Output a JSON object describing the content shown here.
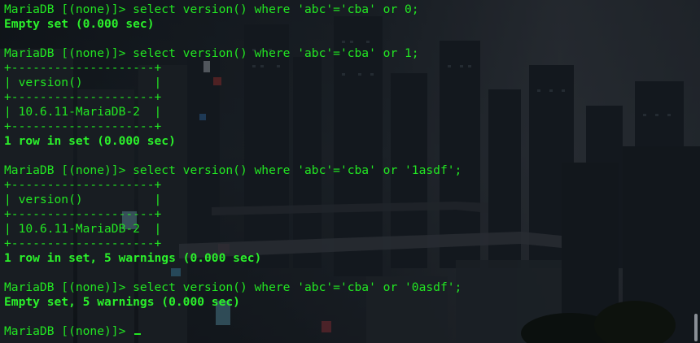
{
  "terminal": {
    "lines": [
      {
        "text": "MariaDB [(none)]> select version() where 'abc'='cba' or 0;",
        "bold": false
      },
      {
        "text": "Empty set (0.000 sec)",
        "bold": true
      },
      {
        "text": "",
        "bold": false
      },
      {
        "text": "MariaDB [(none)]> select version() where 'abc'='cba' or 1;",
        "bold": false
      },
      {
        "text": "+--------------------+",
        "bold": false
      },
      {
        "text": "| version()          |",
        "bold": false
      },
      {
        "text": "+--------------------+",
        "bold": false
      },
      {
        "text": "| 10.6.11-MariaDB-2  |",
        "bold": false
      },
      {
        "text": "+--------------------+",
        "bold": false
      },
      {
        "text": "1 row in set (0.000 sec)",
        "bold": true
      },
      {
        "text": "",
        "bold": false
      },
      {
        "text": "MariaDB [(none)]> select version() where 'abc'='cba' or '1asdf';",
        "bold": false
      },
      {
        "text": "+--------------------+",
        "bold": false
      },
      {
        "text": "| version()          |",
        "bold": false
      },
      {
        "text": "+--------------------+",
        "bold": false
      },
      {
        "text": "| 10.6.11-MariaDB-2  |",
        "bold": false
      },
      {
        "text": "+--------------------+",
        "bold": false
      },
      {
        "text": "1 row in set, 5 warnings (0.000 sec)",
        "bold": true
      },
      {
        "text": "",
        "bold": false
      },
      {
        "text": "MariaDB [(none)]> select version() where 'abc'='cba' or '0asdf';",
        "bold": false
      },
      {
        "text": "Empty set, 5 warnings (0.000 sec)",
        "bold": true
      },
      {
        "text": "",
        "bold": false
      }
    ],
    "prompt": "MariaDB [(none)]> ",
    "cursor_icon": "block-cursor",
    "colors": {
      "text": "#22e622",
      "background": "#0d1116"
    }
  }
}
